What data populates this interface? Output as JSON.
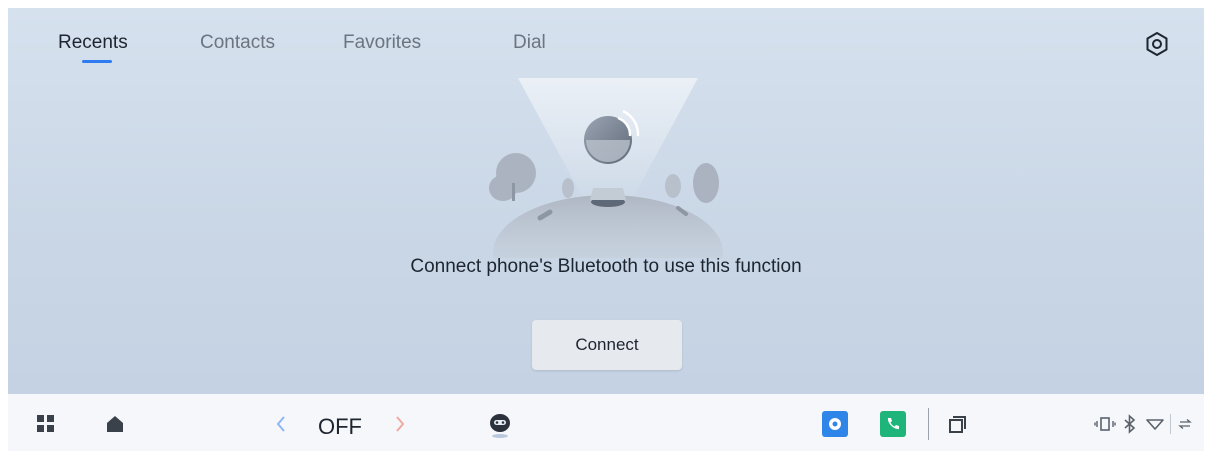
{
  "tabs": [
    {
      "label": "Recents",
      "active": true
    },
    {
      "label": "Contacts",
      "active": false
    },
    {
      "label": "Favorites",
      "active": false
    },
    {
      "label": "Dial",
      "active": false
    }
  ],
  "settings_icon": "settings-hex-icon",
  "empty_state": {
    "illustration": "bluetooth-phone-planet-illustration",
    "message": "Connect phone's Bluetooth to use this function",
    "button_label": "Connect"
  },
  "taskbar": {
    "apps_icon": "app-grid-icon",
    "home_icon": "home-icon",
    "climate_value": "OFF",
    "assistant_icon": "robot-assistant-icon",
    "apps": [
      {
        "name": "settings-app",
        "color": "#2f86e8"
      },
      {
        "name": "phone-app",
        "color": "#1fb57a"
      }
    ],
    "status_icons": [
      "vibrate-icon",
      "bluetooth-icon",
      "wifi-icon",
      "data-arrows-icon"
    ]
  },
  "colors": {
    "accent": "#2f7cf0",
    "background": "#cad7e6",
    "taskbar": "#f5f7fa"
  }
}
